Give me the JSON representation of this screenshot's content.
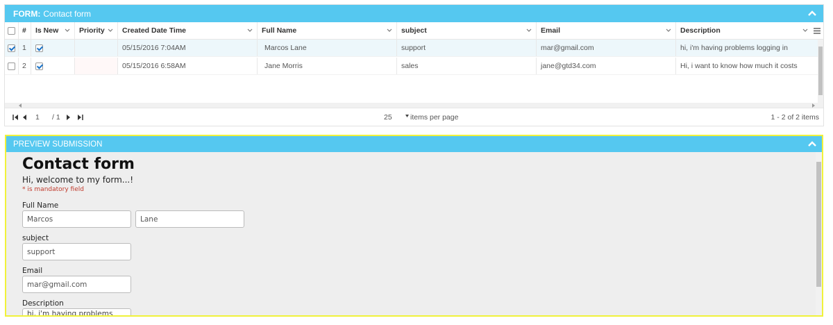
{
  "form_panel": {
    "title_prefix": "FORM:",
    "title": "Contact form",
    "columns": [
      "#",
      "Is New",
      "Priority",
      "Created Date Time",
      "Full Name",
      "subject",
      "Email",
      "Description"
    ],
    "rows": [
      {
        "num": "1",
        "selected": true,
        "is_new": true,
        "priority": "",
        "created": "05/15/2016 7:04AM",
        "full_name": "Marcos Lane",
        "subject": "support",
        "email": "mar@gmail.com",
        "description": "hi, i'm having problems logging in"
      },
      {
        "num": "2",
        "selected": false,
        "is_new": true,
        "priority": "",
        "created": "05/15/2016 6:58AM",
        "full_name": "Jane Morris",
        "subject": "sales",
        "email": "jane@gtd34.com",
        "description": "Hi, i want to know how much it costs"
      }
    ],
    "pager": {
      "page": "1",
      "page_total": "/ 1",
      "page_size": "25",
      "items_per_page_label": "items per page",
      "range": "1 - 2 of 2 items"
    }
  },
  "preview_panel": {
    "title": "PREVIEW SUBMISSION",
    "form_title": "Contact form",
    "welcome": "Hi, welcome to my form...!",
    "mandatory_note": "* is mandatory field",
    "fields": {
      "full_name_label": "Full Name",
      "first_name": "Marcos",
      "last_name": "Lane",
      "subject_label": "subject",
      "subject": "support",
      "email_label": "Email",
      "email": "mar@gmail.com",
      "description_label": "Description",
      "description": "hi, i'm having problems logging in"
    }
  },
  "colors": {
    "header_blue": "#55c8f0",
    "highlight_yellow": "#f0f23a",
    "mandatory_red": "#c0392b",
    "selected_row": "#edf7fb"
  }
}
